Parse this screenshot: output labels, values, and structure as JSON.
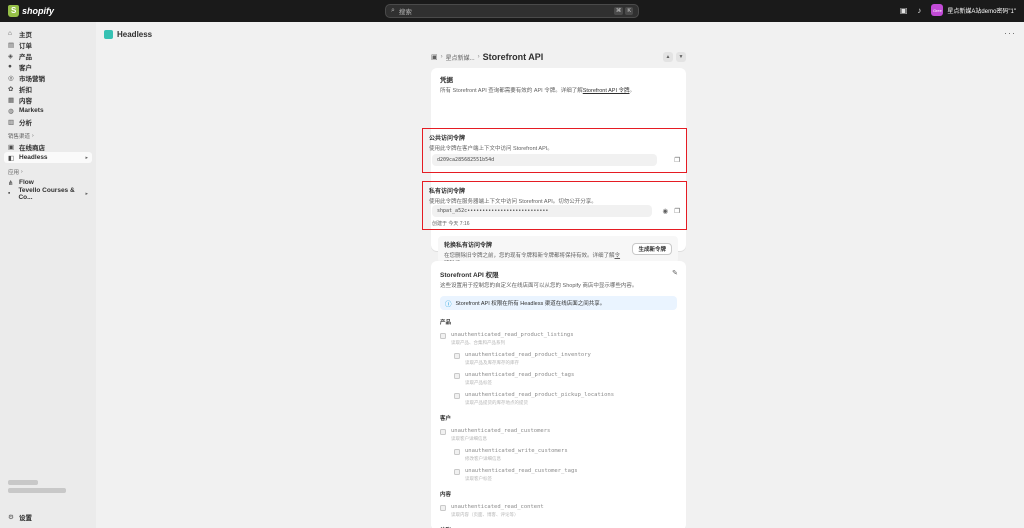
{
  "topbar": {
    "brand": "shopify",
    "search_placeholder": "搜索",
    "kbd": [
      "⌘",
      "K"
    ],
    "store_avatar": "Gree",
    "store_name": "星点新媒A站demo密码\"1\""
  },
  "sidebar": {
    "items": [
      {
        "label": "主页",
        "icon": "home-icon"
      },
      {
        "label": "订单",
        "icon": "orders-icon"
      },
      {
        "label": "产品",
        "icon": "products-icon"
      },
      {
        "label": "客户",
        "icon": "customers-icon"
      },
      {
        "label": "市场营销",
        "icon": "marketing-icon"
      },
      {
        "label": "折扣",
        "icon": "discount-icon"
      },
      {
        "label": "内容",
        "icon": "content-icon"
      },
      {
        "label": "Markets",
        "icon": "globe-icon"
      },
      {
        "label": "分析",
        "icon": "analytics-icon"
      }
    ],
    "sales_channels_label": "销售渠道",
    "channels": [
      {
        "label": "在线商店"
      },
      {
        "label": "Headless"
      }
    ],
    "apps_label": "应用",
    "apps": [
      {
        "label": "Flow"
      },
      {
        "label": "Tevello Courses & Co..."
      }
    ],
    "settings_label": "设置"
  },
  "header": {
    "app_title": "Headless"
  },
  "breadcrumb": {
    "parent": "星点新媒...",
    "title": "Storefront API"
  },
  "credentials": {
    "title": "凭据",
    "desc_prefix": "所有 Storefront API 查询都需要有效的 API 令牌。详细了解",
    "desc_link": "Storefront API 令牌",
    "desc_suffix": "。",
    "public": {
      "title": "公共访问令牌",
      "desc": "使用此令牌在客户端上下文中访问 Storefront API。",
      "value": "d209ca285682551b54d"
    },
    "private": {
      "title": "私有访问令牌",
      "desc": "使用此令牌在服务器端上下文中访问 Storefront API。切勿公开分享。",
      "value": "shpat_a52c•••••••••••••••••••••••••••",
      "created": "创建于 今天 7:16"
    },
    "rotate": {
      "title": "轮换私有访问令牌",
      "desc_prefix": "在您删除旧令牌之前，您的现有令牌和新令牌都将保持有效。详细了解",
      "desc_link": "令牌轮换",
      "desc_suffix": "。",
      "button": "生成新令牌"
    }
  },
  "permissions": {
    "title": "Storefront API 权限",
    "desc": "这些设置用于控制您的自定义在线店面可以从您的 Shopify 商店中显示哪些内容。",
    "banner": "Storefront API 权限在所有 Headless 渠道在线店面之间共享。",
    "groups": [
      {
        "label": "产品",
        "items": [
          {
            "name": "unauthenticated_read_product_listings",
            "desc": "读取产品、合集和产品系列",
            "child": false
          },
          {
            "name": "unauthenticated_read_product_inventory",
            "desc": "读取产品及库存库存的库存",
            "child": true
          },
          {
            "name": "unauthenticated_read_product_tags",
            "desc": "读取产品标签",
            "child": true
          },
          {
            "name": "unauthenticated_read_product_pickup_locations",
            "desc": "读取产品提货的库存地点的提货",
            "child": true
          }
        ]
      },
      {
        "label": "客户",
        "items": [
          {
            "name": "unauthenticated_read_customers",
            "desc": "读取客户详细信息",
            "child": false
          },
          {
            "name": "unauthenticated_write_customers",
            "desc": "修改客户详细信息",
            "child": true
          },
          {
            "name": "unauthenticated_read_customer_tags",
            "desc": "读取客户标签",
            "child": true
          }
        ]
      },
      {
        "label": "内容",
        "items": [
          {
            "name": "unauthenticated_read_content",
            "desc": "读取内容（页面、博客、评论等）",
            "child": false
          }
        ]
      },
      {
        "label": "结账",
        "items": []
      }
    ]
  }
}
